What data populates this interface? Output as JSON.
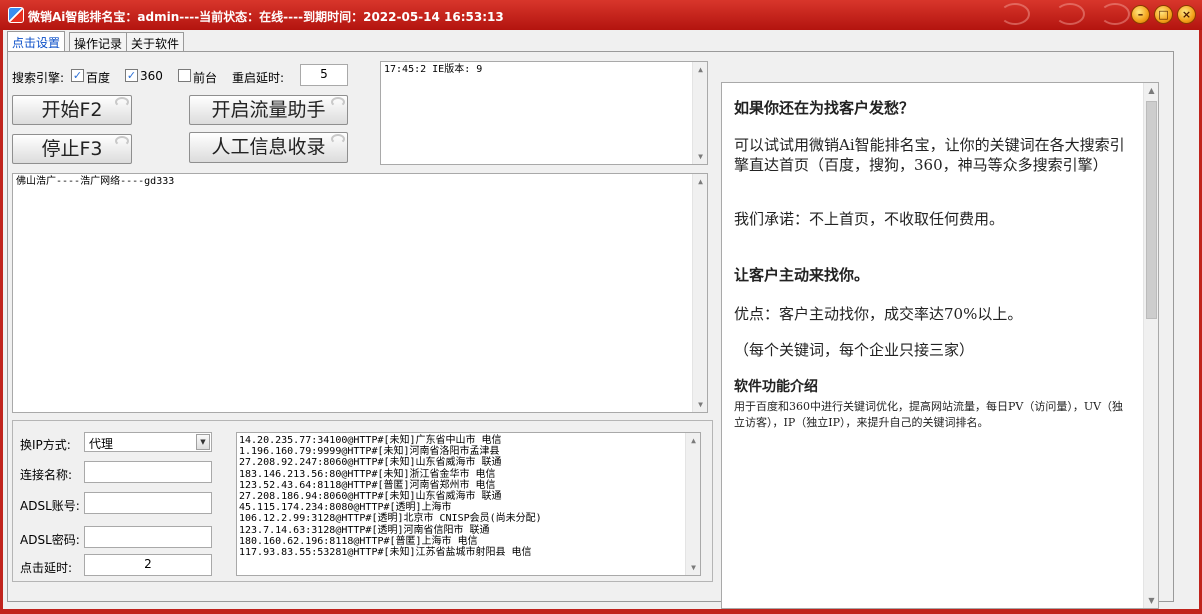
{
  "window": {
    "title": "微销Ai智能排名宝：admin----当前状态：在线----到期时间：2022-05-14 16:53:13"
  },
  "tabs": [
    {
      "label": "点击设置"
    },
    {
      "label": "操作记录"
    },
    {
      "label": "关于软件"
    }
  ],
  "engine": {
    "label": "搜索引擎:",
    "options": [
      {
        "label": "百度",
        "checked": true
      },
      {
        "label": "360",
        "checked": true
      },
      {
        "label": "前台",
        "checked": false
      }
    ],
    "restart_delay_label": "重启延时:",
    "restart_delay_value": "5"
  },
  "buttons": {
    "start": "开始F2",
    "stop": "停止F3",
    "traffic": "开启流量助手",
    "manual": "人工信息收录"
  },
  "status_log": "17:45:2 IE版本: 9",
  "keyword_text": "佛山浩广----浩广网络----gd333",
  "settings": {
    "ip_mode_label": "换IP方式:",
    "ip_mode_value": "代理",
    "conn_name_label": "连接名称:",
    "conn_name_value": "",
    "adsl_user_label": "ADSL账号:",
    "adsl_user_value": "",
    "adsl_pass_label": "ADSL密码:",
    "adsl_pass_value": "",
    "click_delay_label": "点击延时:",
    "click_delay_value": "2"
  },
  "proxy_list": [
    "14.20.235.77:34100@HTTP#[未知]广东省中山市 电信",
    "1.196.160.79:9999@HTTP#[未知]河南省洛阳市孟津县",
    "27.208.92.247:8060@HTTP#[未知]山东省威海市 联通",
    "183.146.213.56:80@HTTP#[未知]浙江省金华市 电信",
    "123.52.43.64:8118@HTTP#[普匿]河南省郑州市 电信",
    "27.208.186.94:8060@HTTP#[未知]山东省威海市 联通",
    "45.115.174.234:8080@HTTP#[透明]上海市",
    "106.12.2.99:3128@HTTP#[透明]北京市 CNISP会员(尚未分配)",
    "123.7.14.63:3128@HTTP#[透明]河南省信阳市 联通",
    "180.160.62.196:8118@HTTP#[普匿]上海市 电信",
    "117.93.83.55:53281@HTTP#[未知]江苏省盐城市射阳县 电信"
  ],
  "info": {
    "heading1": "如果你还在为找客户发愁？",
    "para1": "可以试试用微销Ai智能排名宝，让你的关键词在各大搜索引擎直达首页（百度，搜狗，360，神马等众多搜索引擎）",
    "para2": "我们承诺：不上首页，不收取任何费用。",
    "heading2": "让客户主动来找你。",
    "para3": "优点：客户主动找你，成交率达70%以上。",
    "para4": "（每个关键词，每个企业只接三家）",
    "heading3": "软件功能介绍",
    "para5": "用于百度和360中进行关键词优化，提高网站流量，每日PV（访问量），UV（独立访客），IP（独立IP），来提升自己的关键词排名。"
  },
  "colors": {
    "titlebar": "#c0231c",
    "tab_active_text": "#0b4fc8"
  }
}
